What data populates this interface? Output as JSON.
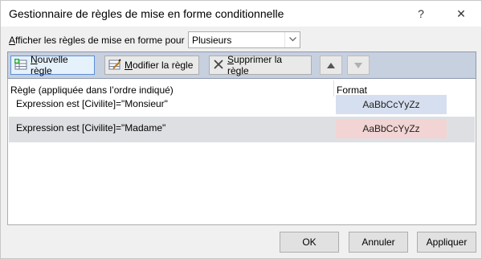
{
  "dialog": {
    "title": "Gestionnaire de règles de mise en forme conditionnelle",
    "help_glyph": "?",
    "close_glyph": "✕"
  },
  "show_rules": {
    "label_prefix": "A",
    "label_rest": "fficher les règles de mise en forme pour :",
    "selected": "Plusieurs"
  },
  "toolbar": {
    "new_rule_prefix": "N",
    "new_rule_rest": "ouvelle règle",
    "edit_rule_prefix": "M",
    "edit_rule_rest": "odifier la règle",
    "delete_rule_prefix": "S",
    "delete_rule_rest": "upprimer la règle"
  },
  "list": {
    "col_rule": "Règle (appliquée dans l’ordre indiqué)",
    "col_format": "Format",
    "rows": [
      {
        "expression": "Expression est [Civilite]=\"Monsieur\"",
        "preview": "AaBbCcYyZz",
        "color": "#d6dff0"
      },
      {
        "expression": "Expression est [Civilite]=\"Madame\"",
        "preview": "AaBbCcYyZz",
        "color": "#f2d4d4"
      }
    ]
  },
  "buttons": {
    "ok": "OK",
    "cancel": "Annuler",
    "apply": "Appliquer"
  }
}
